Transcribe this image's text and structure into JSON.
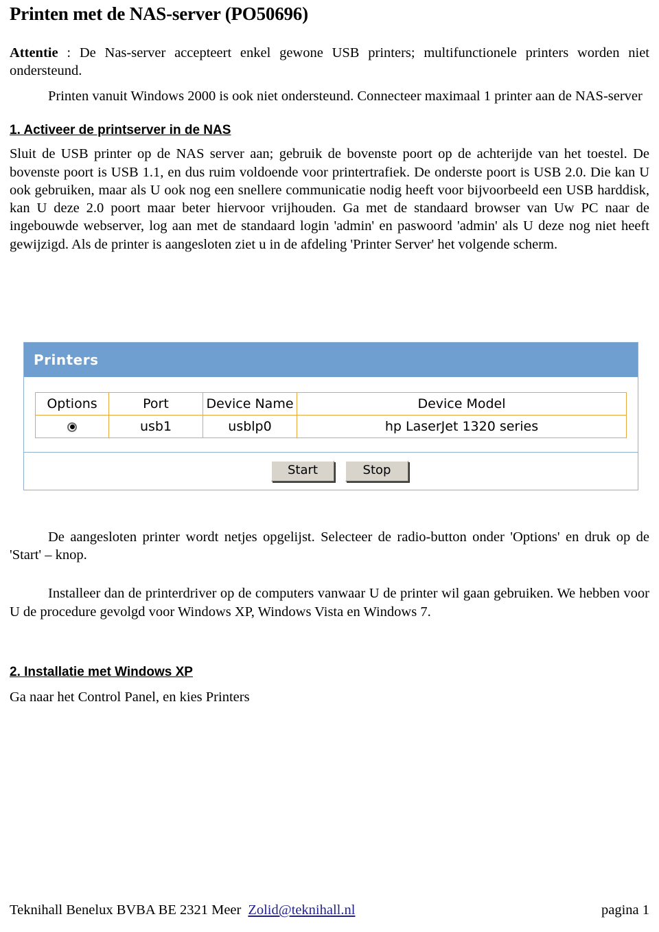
{
  "document": {
    "title": "Printen met de NAS-server (PO50696)",
    "attention": {
      "label": "Attentie",
      "rest": " : De Nas-server accepteert enkel gewone USB printers; multifunctionele printers worden niet ondersteund."
    },
    "intro_paragraph": "Printen vanuit Windows 2000 is ook niet ondersteund. Connecteer maximaal 1 printer aan de NAS-server",
    "section1": {
      "heading": "1. Activeer de printserver in de NAS",
      "body": "Sluit de USB printer op de NAS server aan; gebruik de bovenste poort op de achterijde van het toestel. De bovenste poort is USB 1.1, en dus ruim voldoende voor printertrafiek. De onderste poort is USB 2.0. Die kan U ook gebruiken, maar als U ook nog een snellere communicatie nodig heeft voor bijvoorbeeld een USB harddisk, kan U deze 2.0 poort maar beter hiervoor vrijhouden. Ga met de standaard browser van Uw PC naar de ingebouwde webserver, log aan met de standaard login 'admin' en paswoord 'admin' als U deze nog niet heeft gewijzigd. Als de printer is aangesloten ziet u in de afdeling 'Printer Server' het volgende scherm."
    },
    "after_screenshot": {
      "paragraph1": "De aangesloten printer wordt netjes opgelijst. Selecteer de radio-button onder 'Options' en druk op de 'Start' – knop.",
      "paragraph2": "Installeer dan de printerdriver op de computers vanwaar U de printer wil gaan gebruiken. We hebben voor U de procedure gevolgd voor Windows XP, Windows Vista en Windows 7."
    },
    "section2": {
      "heading": "2. Installatie met Windows XP",
      "body": "Ga naar het Control Panel, en kies Printers"
    },
    "footer": {
      "company": "Teknihall Benelux BVBA   BE 2321 Meer",
      "email": "Zolid@teknihall.nl",
      "page": "pagina 1"
    }
  },
  "printer_screenshot": {
    "panel_title": "Printers",
    "table": {
      "headers": [
        "Options",
        "Port",
        "Device Name",
        "Device Model"
      ],
      "rows": [
        {
          "options": "radio-selected",
          "port": "usb1",
          "device_name": "usblp0",
          "device_model": "hp LaserJet 1320 series"
        }
      ]
    },
    "buttons": {
      "start": "Start",
      "stop": "Stop"
    },
    "colors": {
      "titlebar": "#6f9fd1",
      "panel_border": "#91b0cf",
      "table_border": "#e8a83e",
      "button_face": "#d8d4cc"
    }
  }
}
